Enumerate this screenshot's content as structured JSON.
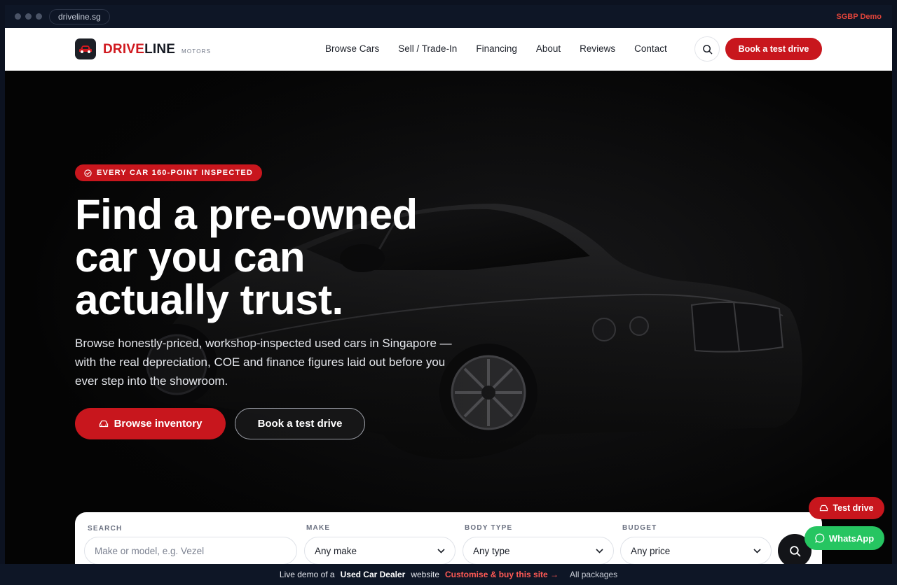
{
  "browser": {
    "url": "driveline.sg",
    "demo_tag": "SGBP Demo"
  },
  "header": {
    "logo_primary": "DRIVE",
    "logo_secondary": "LINE",
    "logo_sub": "MOTORS",
    "nav": [
      "Browse Cars",
      "Sell / Trade-In",
      "Financing",
      "About",
      "Reviews",
      "Contact"
    ],
    "search_icon": "search-icon",
    "cta_label": "Book a test drive"
  },
  "hero": {
    "badge": "EVERY CAR 160-POINT INSPECTED",
    "headline_line1": "Find a pre-owned",
    "headline_line2": "car you can",
    "headline_line3": "actually trust.",
    "subcopy": "Browse honestly-priced, workshop-inspected used cars in Singapore — with the real depreciation, COE and finance figures laid out before you ever step into the showroom.",
    "primary_button": "Browse inventory",
    "secondary_button": "Book a test drive"
  },
  "search_panel": {
    "search_label": "SEARCH",
    "search_placeholder": "Make or model, e.g. Vezel",
    "make_label": "MAKE",
    "make_value": "Any make",
    "body_label": "BODY TYPE",
    "body_value": "Any type",
    "budget_label": "BUDGET",
    "budget_value": "Any price"
  },
  "floating": {
    "test_drive": "Test drive",
    "whatsapp": "WhatsApp"
  },
  "demo_bar": {
    "prefix": "Live demo of a",
    "product": "Used Car Dealer",
    "suffix": "website",
    "cta": "Customise & buy this site →",
    "packages": "All packages"
  },
  "colors": {
    "brand_red": "#c8161d",
    "whatsapp_green": "#26c561",
    "chrome_bg": "#0e1626"
  }
}
